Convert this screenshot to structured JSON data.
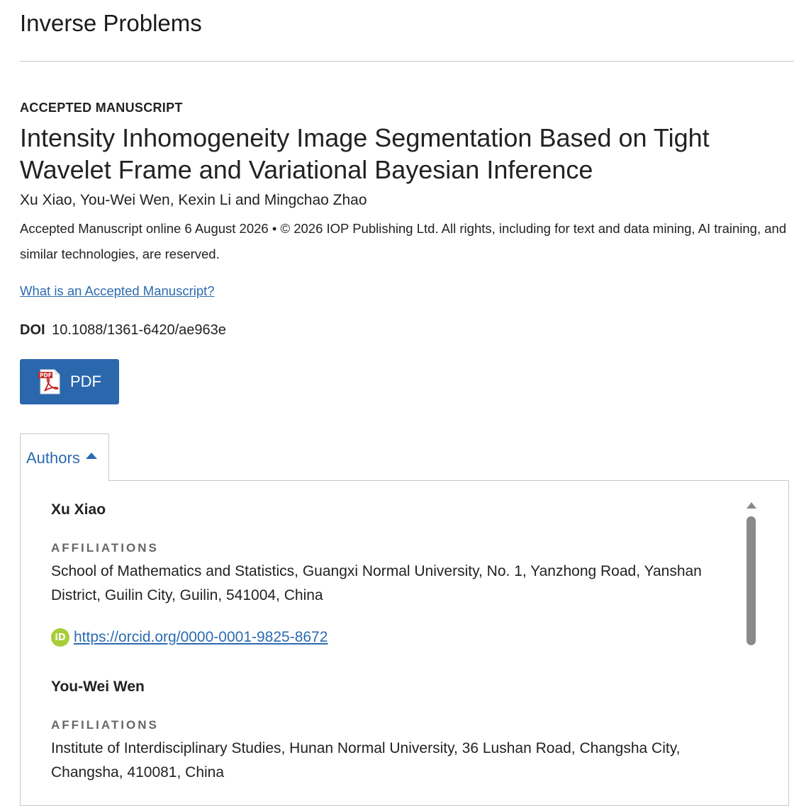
{
  "journal": {
    "title": "Inverse Problems"
  },
  "article": {
    "type_label": "ACCEPTED MANUSCRIPT",
    "title": "Intensity Inhomogeneity Image Segmentation Based on Tight Wavelet Frame and Variational Bayesian Inference",
    "authors": "Xu Xiao, You-Wei Wen, Kexin Li and Mingchao Zhao",
    "publication_info": "Accepted Manuscript online 6 August 2026 • © 2026 IOP Publishing Ltd. All rights, including for text and data mining, AI training, and similar technologies, are reserved.",
    "am_link": "What is an Accepted Manuscript?",
    "doi_label": "DOI",
    "doi_value": "10.1088/1361-6420/ae963e",
    "pdf_label": "PDF"
  },
  "tabs": {
    "authors_label": "Authors"
  },
  "author_list": [
    {
      "name": "Xu Xiao",
      "affiliations_label": "AFFILIATIONS",
      "affiliation": "School of Mathematics and Statistics, Guangxi Normal University, No. 1, Yanzhong Road, Yanshan District, Guilin City, Guilin, 541004, China",
      "orcid": "https://orcid.org/0000-0001-9825-8672"
    },
    {
      "name": "You-Wei Wen",
      "affiliations_label": "AFFILIATIONS",
      "affiliation": "Institute of Interdisciplinary Studies, Hunan Normal University, 36 Lushan Road, Changsha City, Changsha, 410081, China"
    }
  ],
  "colors": {
    "link": "#2c6bb0",
    "button": "#2b67ad",
    "orcid": "#a6ce39"
  },
  "icons": {
    "pdf": "pdf-icon",
    "orcid": "orcid-icon",
    "tab_caret": "caret-up-icon",
    "scroll": "scroll-up-icon"
  }
}
